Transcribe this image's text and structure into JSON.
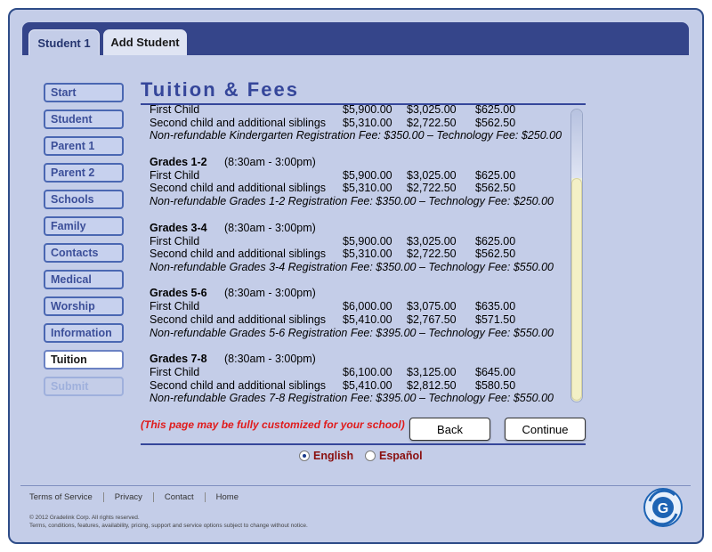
{
  "tabs": [
    {
      "label": "Student 1"
    },
    {
      "label": "Add Student"
    }
  ],
  "sidebar": {
    "items": [
      {
        "label": "Start"
      },
      {
        "label": "Student"
      },
      {
        "label": "Parent 1"
      },
      {
        "label": "Parent 2"
      },
      {
        "label": "Schools"
      },
      {
        "label": "Family"
      },
      {
        "label": "Contacts"
      },
      {
        "label": "Medical"
      },
      {
        "label": "Worship"
      },
      {
        "label": "Information"
      },
      {
        "label": "Tuition"
      },
      {
        "label": "Submit"
      }
    ],
    "active": "Tuition",
    "disabled": "Submit"
  },
  "page_title": "Tuition & Fees",
  "kindergarten": {
    "rows": [
      {
        "label": "First Child",
        "v1": "$5,900.00",
        "v2": "$3,025.00",
        "v3": "$625.00"
      },
      {
        "label": "Second child and additional siblings",
        "v1": "$5,310.00",
        "v2": "$2,722.50",
        "v3": "$562.50"
      }
    ],
    "note": "Non-refundable Kindergarten Registration Fee: $350.00 – Technology Fee: $250.00"
  },
  "groups": [
    {
      "name": "Grades 1-2",
      "hours": "(8:30am - 3:00pm)",
      "rows": [
        {
          "label": "First Child",
          "v1": "$5,900.00",
          "v2": "$3,025.00",
          "v3": "$625.00"
        },
        {
          "label": "Second child and additional siblings",
          "v1": "$5,310.00",
          "v2": "$2,722.50",
          "v3": "$562.50"
        }
      ],
      "note": "Non-refundable Grades 1-2 Registration Fee: $350.00 – Technology Fee: $250.00"
    },
    {
      "name": "Grades 3-4",
      "hours": "(8:30am - 3:00pm)",
      "rows": [
        {
          "label": "First Child",
          "v1": "$5,900.00",
          "v2": "$3,025.00",
          "v3": "$625.00"
        },
        {
          "label": "Second child and additional siblings",
          "v1": "$5,310.00",
          "v2": "$2,722.50",
          "v3": "$562.50"
        }
      ],
      "note": "Non-refundable Grades 3-4 Registration Fee: $350.00 – Technology Fee: $550.00"
    },
    {
      "name": "Grades 5-6",
      "hours": "(8:30am - 3:00pm)",
      "rows": [
        {
          "label": "First Child",
          "v1": "$6,000.00",
          "v2": "$3,075.00",
          "v3": "$635.00"
        },
        {
          "label": "Second child and additional siblings",
          "v1": "$5,410.00",
          "v2": "$2,767.50",
          "v3": "$571.50"
        }
      ],
      "note": "Non-refundable Grades 5-6 Registration Fee: $395.00 – Technology Fee: $550.00"
    },
    {
      "name": "Grades 7-8",
      "hours": "(8:30am - 3:00pm)",
      "rows": [
        {
          "label": "First Child",
          "v1": "$6,100.00",
          "v2": "$3,125.00",
          "v3": "$645.00"
        },
        {
          "label": "Second child and additional siblings",
          "v1": "$5,410.00",
          "v2": "$2,812.50",
          "v3": "$580.50"
        }
      ],
      "note": "Non-refundable Grades 7-8 Registration Fee: $395.00 – Technology Fee: $550.00"
    }
  ],
  "custom_note": "(This page may be fully customized for your school)",
  "actions": {
    "back": "Back",
    "continue": "Continue"
  },
  "languages": {
    "english": "English",
    "spanish": "Español",
    "selected": "English"
  },
  "footer": {
    "links": [
      "Terms of Service",
      "Privacy",
      "Contact",
      "Home"
    ],
    "copyright": "© 2012 Gradelink Corp. All rights reserved.",
    "terms": "Terms, conditions, features, availability, pricing, support and service options subject to change without notice.",
    "logo_letter": "G"
  },
  "colors": {
    "brand": "#35458a",
    "accent": "#35469a",
    "alert": "#e01b1b",
    "lang": "#8a1010"
  }
}
